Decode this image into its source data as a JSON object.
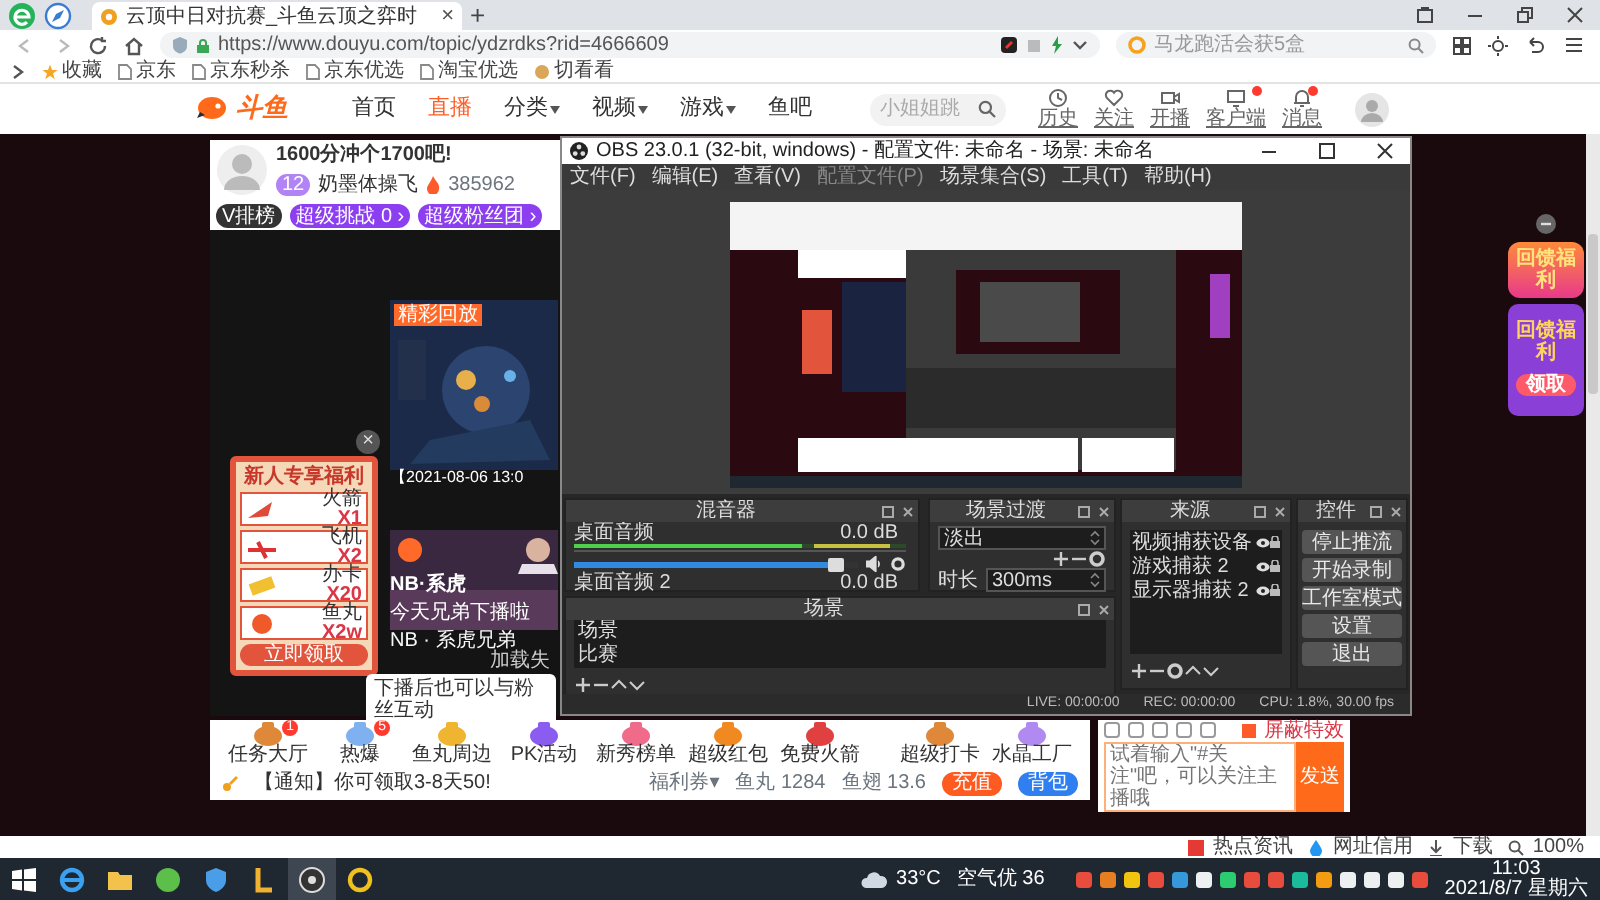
{
  "browser": {
    "tab": {
      "title": "云顶中日对抗赛_斗鱼云顶之弈时",
      "selected": true,
      "close": "×"
    },
    "new_tab": "+",
    "url": "https://www.douyu.com/topic/ydzrdks?rid=4666609",
    "search_placeholder": "马龙跑活会获5盒",
    "bookmarks": [
      {
        "label": "收藏",
        "kind": "star"
      },
      {
        "label": "京东",
        "kind": "page"
      },
      {
        "label": "京东秒杀",
        "kind": "page"
      },
      {
        "label": "京东优选",
        "kind": "page"
      },
      {
        "label": "淘宝优选",
        "kind": "page"
      },
      {
        "label": "切看看",
        "kind": "site"
      }
    ]
  },
  "site": {
    "logo_text": "斗鱼",
    "nav": [
      {
        "label": "首页",
        "selected": false,
        "dropdown": false
      },
      {
        "label": "直播",
        "selected": true,
        "dropdown": false
      },
      {
        "label": "分类",
        "selected": false,
        "dropdown": true
      },
      {
        "label": "视频",
        "selected": false,
        "dropdown": true
      },
      {
        "label": "游戏",
        "selected": false,
        "dropdown": true
      },
      {
        "label": "鱼吧",
        "selected": false,
        "dropdown": false
      }
    ],
    "search_placeholder": "小姐姐跳",
    "actions": [
      {
        "label": "历史",
        "kind": "clock",
        "dot": false
      },
      {
        "label": "关注",
        "kind": "heart",
        "dot": false
      },
      {
        "label": "开播",
        "kind": "camera",
        "dot": false
      },
      {
        "label": "客户端",
        "kind": "monitor",
        "dot": true
      },
      {
        "label": "消息",
        "kind": "bell",
        "dot": true
      }
    ]
  },
  "room": {
    "title": "1600分冲个1700吧!",
    "level": "12",
    "anchor": "奶墨体操飞",
    "hot": "385962",
    "buttons": [
      {
        "label": "V排榜",
        "kind": "dark"
      },
      {
        "label": "超级挑战 0 ›",
        "kind": "purple"
      },
      {
        "label": "超级粉丝团 ›",
        "kind": "purple"
      }
    ]
  },
  "videos": [
    {
      "tag": "精彩回放",
      "caption": "【2021-08-06 13:0"
    },
    {
      "overlay": "NB·系虎",
      "subtitle": "今天兄弟下播啦",
      "caption": "NB · 系虎兄弟"
    }
  ],
  "loading": "加载失",
  "promo": {
    "title": "新人专享福利",
    "items": [
      {
        "name": "火箭",
        "qty": "X1"
      },
      {
        "name": "飞机",
        "qty": "X2"
      },
      {
        "name": "办卡",
        "qty": "X20"
      },
      {
        "name": "鱼丸",
        "qty": "X2w"
      }
    ],
    "button": "立即领取",
    "close": "×"
  },
  "toast": "下播后也可以与粉丝互动",
  "obs": {
    "title": "OBS 23.0.1 (32-bit, windows) - 配置文件: 未命名 - 场景: 未命名",
    "menu": [
      {
        "label": "文件(F)",
        "disabled": false
      },
      {
        "label": "编辑(E)",
        "disabled": false
      },
      {
        "label": "查看(V)",
        "disabled": false
      },
      {
        "label": "配置文件(P)",
        "disabled": true
      },
      {
        "label": "场景集合(S)",
        "disabled": false
      },
      {
        "label": "工具(T)",
        "disabled": false
      },
      {
        "label": "帮助(H)",
        "disabled": false
      }
    ],
    "mixer": {
      "title": "混音器",
      "channels": [
        {
          "name": "桌面音频",
          "reading": "0.0 dB",
          "level": 0.95
        },
        {
          "name": "桌面音频 2",
          "reading": "0.0 dB"
        }
      ]
    },
    "transition": {
      "title": "场景过渡",
      "value": "淡出",
      "duration_label": "时长",
      "duration": "300ms"
    },
    "scenes": {
      "title": "场景",
      "items": [
        "场景",
        "比赛"
      ]
    },
    "sources": {
      "title": "来源",
      "items": [
        "视频捕获设备",
        "游戏捕获 2",
        "显示器捕获 2"
      ]
    },
    "controls": {
      "title": "控件",
      "buttons": [
        "停止推流",
        "开始录制",
        "工作室模式",
        "设置",
        "退出"
      ]
    },
    "status": [
      "LIVE: 00:00:00",
      "REC: 00:00:00",
      "CPU: 1.8%, 30.00 fps"
    ]
  },
  "gift_bar": {
    "gifts": [
      {
        "label": "任务大厅",
        "badge": "1",
        "color": "#e0883a"
      },
      {
        "label": "热爆",
        "badge": "5",
        "color": "#7fb0f0"
      },
      {
        "label": "鱼丸周边",
        "color": "#f0b530"
      },
      {
        "label": "PK活动",
        "color": "#8a5cf0"
      },
      {
        "label": "新秀榜单",
        "color": "#f06a8a"
      },
      {
        "label": "超级红包",
        "color": "#f08a20"
      },
      {
        "label": "免费火箭",
        "color": "#e04040"
      }
    ],
    "right_gifts": [
      {
        "label": "超级打卡",
        "color": "#e0883a"
      },
      {
        "label": "水晶工厂",
        "color": "#b08af0"
      }
    ],
    "notice": "【通知】你可领取3-8天50!",
    "coupon": "福利券▾",
    "fish_balls": "鱼丸 1284",
    "fish_fins": "鱼翅 13.6",
    "recharge": "充值",
    "bag": "背包"
  },
  "chat": {
    "shield": "屏蔽特效",
    "placeholder": "试着输入\"#关注\"吧，可以关注主播哦",
    "send": "发送"
  },
  "right_banner": {
    "badge": "回馈福利",
    "card_title": "回馈福利",
    "button": "领取"
  },
  "status_bar": {
    "items": [
      {
        "label": "热点资讯",
        "kind": "news"
      },
      {
        "label": "网址信用",
        "kind": "drop"
      },
      {
        "label": "下载",
        "kind": "download"
      }
    ],
    "zoom": "100%"
  },
  "taskbar": {
    "temperature": "33°C",
    "air": "空气优 36",
    "time": "11:03",
    "date": "2021/8/7 星期六"
  }
}
